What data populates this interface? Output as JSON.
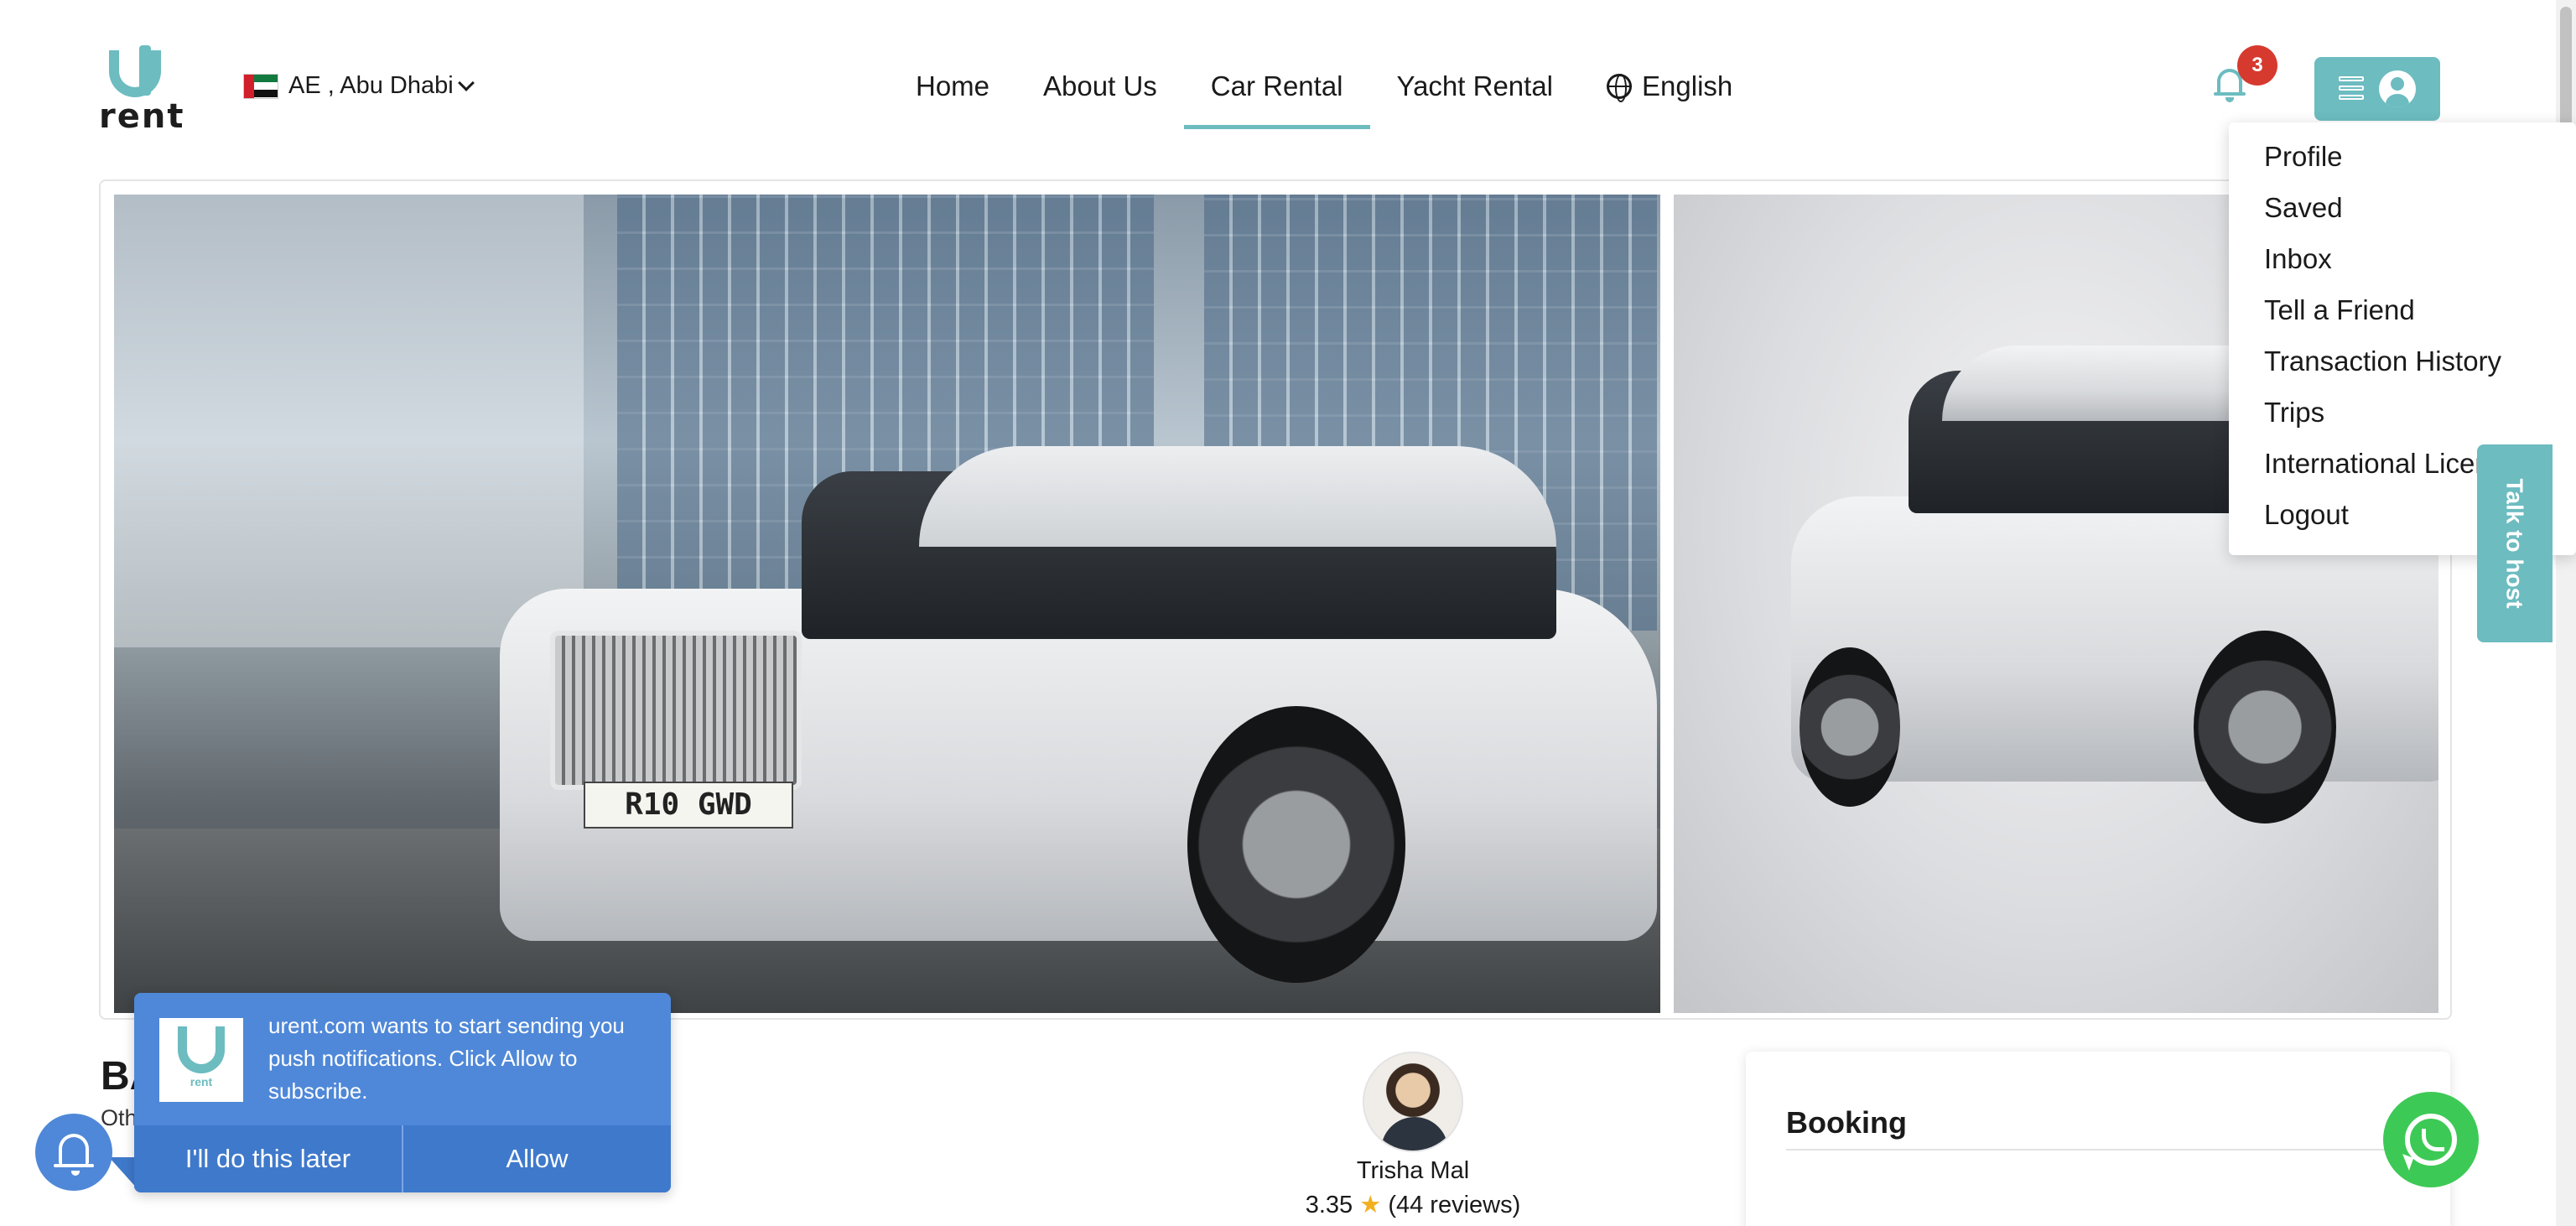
{
  "header": {
    "logo_text": "rent",
    "location": "AE , Abu Dhabi",
    "nav": [
      {
        "label": "Home"
      },
      {
        "label": "About Us"
      },
      {
        "label": "Car Rental",
        "active": true
      },
      {
        "label": "Yacht Rental"
      },
      {
        "label": "English"
      }
    ],
    "notification_count": "3",
    "accent_color": "#6cbcc0"
  },
  "user_menu": {
    "items": [
      {
        "label": "Profile"
      },
      {
        "label": "Saved"
      },
      {
        "label": "Inbox"
      },
      {
        "label": "Tell a Friend"
      },
      {
        "label": "Transaction History"
      },
      {
        "label": "Trips"
      },
      {
        "label": "International License"
      },
      {
        "label": "Logout"
      }
    ]
  },
  "talk_to_host": "Talk to host",
  "gallery": {
    "plate_text": "R10 GWD"
  },
  "listing": {
    "title": "BA",
    "subtitle": "Oth"
  },
  "host": {
    "name": "Trisha Mal",
    "rating": "3.35",
    "reviews": "(44 reviews)"
  },
  "booking": {
    "title": "Booking"
  },
  "push_prompt": {
    "message": "urent.com wants to start sending you push notifications. Click Allow to subscribe.",
    "later_label": "I'll do this later",
    "allow_label": "Allow",
    "logo_label": "rent",
    "color": "#4f88d8"
  }
}
